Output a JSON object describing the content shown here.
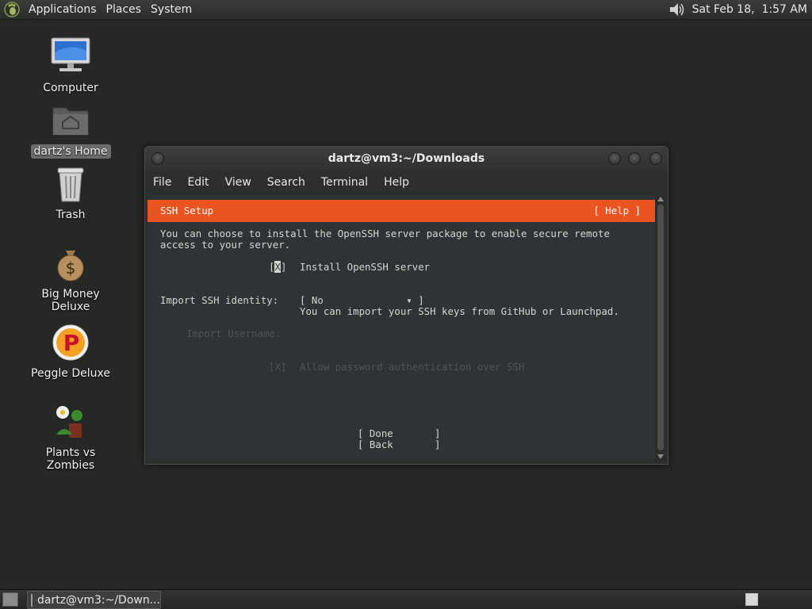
{
  "top_panel": {
    "menus": [
      "Applications",
      "Places",
      "System"
    ],
    "clock": "Sat Feb 18,  1:57 AM"
  },
  "desktop": {
    "icons": [
      {
        "label": "Computer",
        "icon": "computer-icon"
      },
      {
        "label": "dartz's Home",
        "icon": "home-folder-icon"
      },
      {
        "label": "Trash",
        "icon": "trash-icon"
      },
      {
        "label": "Big Money Deluxe",
        "icon": "money-bag-icon"
      },
      {
        "label": "Peggle Deluxe",
        "icon": "peggle-icon"
      },
      {
        "label": "Plants vs Zombies",
        "icon": "plants-vs-zombies-icon"
      }
    ]
  },
  "window": {
    "title": "dartz@vm3:~/Downloads",
    "menus": [
      "File",
      "Edit",
      "View",
      "Search",
      "Terminal",
      "Help"
    ]
  },
  "terminal": {
    "header_title": "SSH Setup",
    "header_help": "[ Help ]",
    "intro_line1": "You can choose to install the OpenSSH server package to enable secure remote",
    "intro_line2": "access to your server.",
    "install_bracket_open": "[",
    "install_mark": "X",
    "install_bracket_close": "]",
    "install_label": "Install OpenSSH server",
    "identity_label": "Import SSH identity:",
    "identity_value": "[ No              ▾ ]",
    "identity_help": "You can import your SSH keys from GitHub or Launchpad.",
    "username_label": "Import Username:",
    "password_check": "[X]",
    "password_label": "Allow password authentication over SSH",
    "done_button": "[ Done       ]",
    "back_button": "[ Back       ]"
  },
  "bottom_panel": {
    "task_label": "dartz@vm3:~/Down..."
  },
  "colors": {
    "accent": "#e95420",
    "terminal_bg": "#2e3436",
    "desktop_bg": "#262826"
  }
}
